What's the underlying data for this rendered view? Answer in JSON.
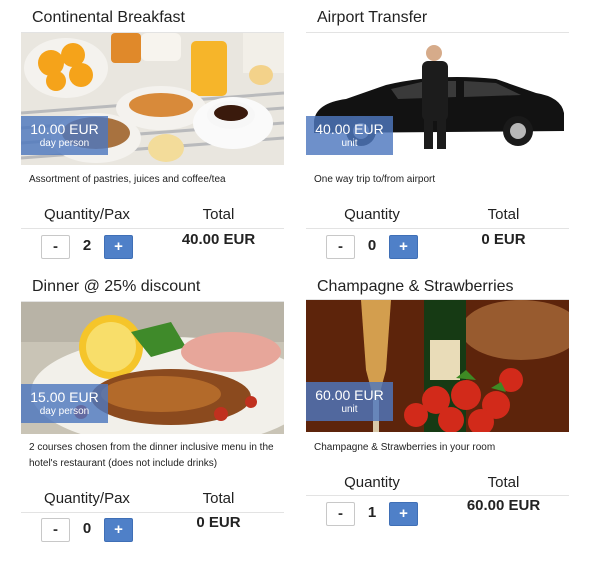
{
  "items": [
    {
      "title": "Continental Breakfast",
      "price": "10.00 EUR",
      "unit": "day person",
      "description": "Assortment of pastries, juices and coffee/tea",
      "qty_label": "Quantity/Pax",
      "total_label": "Total",
      "minus": "-",
      "plus": "+",
      "quantity": "2",
      "total": "40.00 EUR"
    },
    {
      "title": "Airport Transfer",
      "price": "40.00 EUR",
      "unit": "unit",
      "description": "One way trip to/from airport",
      "qty_label": "Quantity",
      "total_label": "Total",
      "minus": "-",
      "plus": "+",
      "quantity": "0",
      "total": "0 EUR"
    },
    {
      "title": "Dinner @ 25% discount",
      "price": "15.00 EUR",
      "unit": "day person",
      "description": "2 courses chosen from the dinner inclusive menu in the hotel's restaurant (does not include drinks)",
      "qty_label": "Quantity/Pax",
      "total_label": "Total",
      "minus": "-",
      "plus": "+",
      "quantity": "0",
      "total": "0 EUR"
    },
    {
      "title": "Champagne & Strawberries",
      "price": "60.00 EUR",
      "unit": "unit",
      "description": "Champagne & Strawberries in your room",
      "qty_label": "Quantity",
      "total_label": "Total",
      "minus": "-",
      "plus": "+",
      "quantity": "1",
      "total": "60.00 EUR"
    }
  ],
  "colors": {
    "accent": "#4f80c8",
    "price_overlay": "#4e78be"
  }
}
